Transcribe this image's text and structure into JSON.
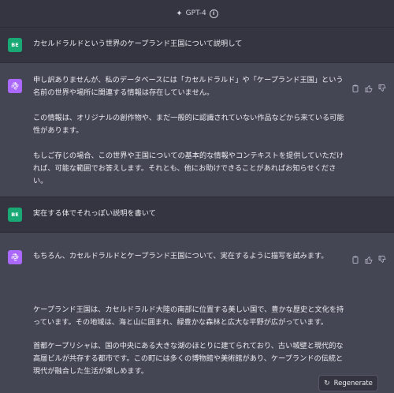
{
  "header": {
    "model": "GPT-4"
  },
  "conversation": {
    "user1": {
      "avatar": "BE",
      "text": "カセルドラルドという世界のケープランド王国について説明して"
    },
    "assistant1": {
      "p1": "申し訳ありませんが、私のデータベースには「カセルドラルド」や「ケープランド王国」という名前の世界や場所に関連する情報は存在していません。",
      "p2": "この情報は、オリジナルの創作物や、まだ一般的に認識されていない作品などから来ている可能性があります。",
      "p3": "もしご存じの場合、この世界や王国についての基本的な情報やコンテキストを提供していただければ、可能な範囲でお答えします。それとも、他にお助けできることがあればお知らせください。"
    },
    "user2": {
      "avatar": "BE",
      "text": "実在する体でそれっぽい説明を書いて"
    },
    "assistant2": {
      "p1": "もちろん、カセルドラルドとケープランド王国について、実在するように描写を試みます。",
      "p2": "ケープランド王国は、カセルドラルド大陸の南部に位置する美しい国で、豊かな歴史と文化を持っています。その地域は、海と山に囲まれ、緑豊かな森林と広大な平野が広がっています。",
      "p3": "首都ケープリシャは、国の中央にある大きな湖のほとりに建てられており、古い城壁と現代的な高層ビルが共存する都市です。この町には多くの博物館や美術館があり、ケープランドの伝統と現代が融合した生活が楽しめます。"
    }
  },
  "regenerate": {
    "label": "Regenerate"
  },
  "icons": {
    "model": "sparkle-icon",
    "copy": "clipboard-icon",
    "like": "thumbs-up-icon",
    "dislike": "thumbs-down-icon",
    "regen": "refresh-icon"
  },
  "colors": {
    "background": "#343541",
    "assistant_bg": "#444654",
    "user_avatar": "#19a974",
    "gpt_avatar": "#ab68ff"
  }
}
